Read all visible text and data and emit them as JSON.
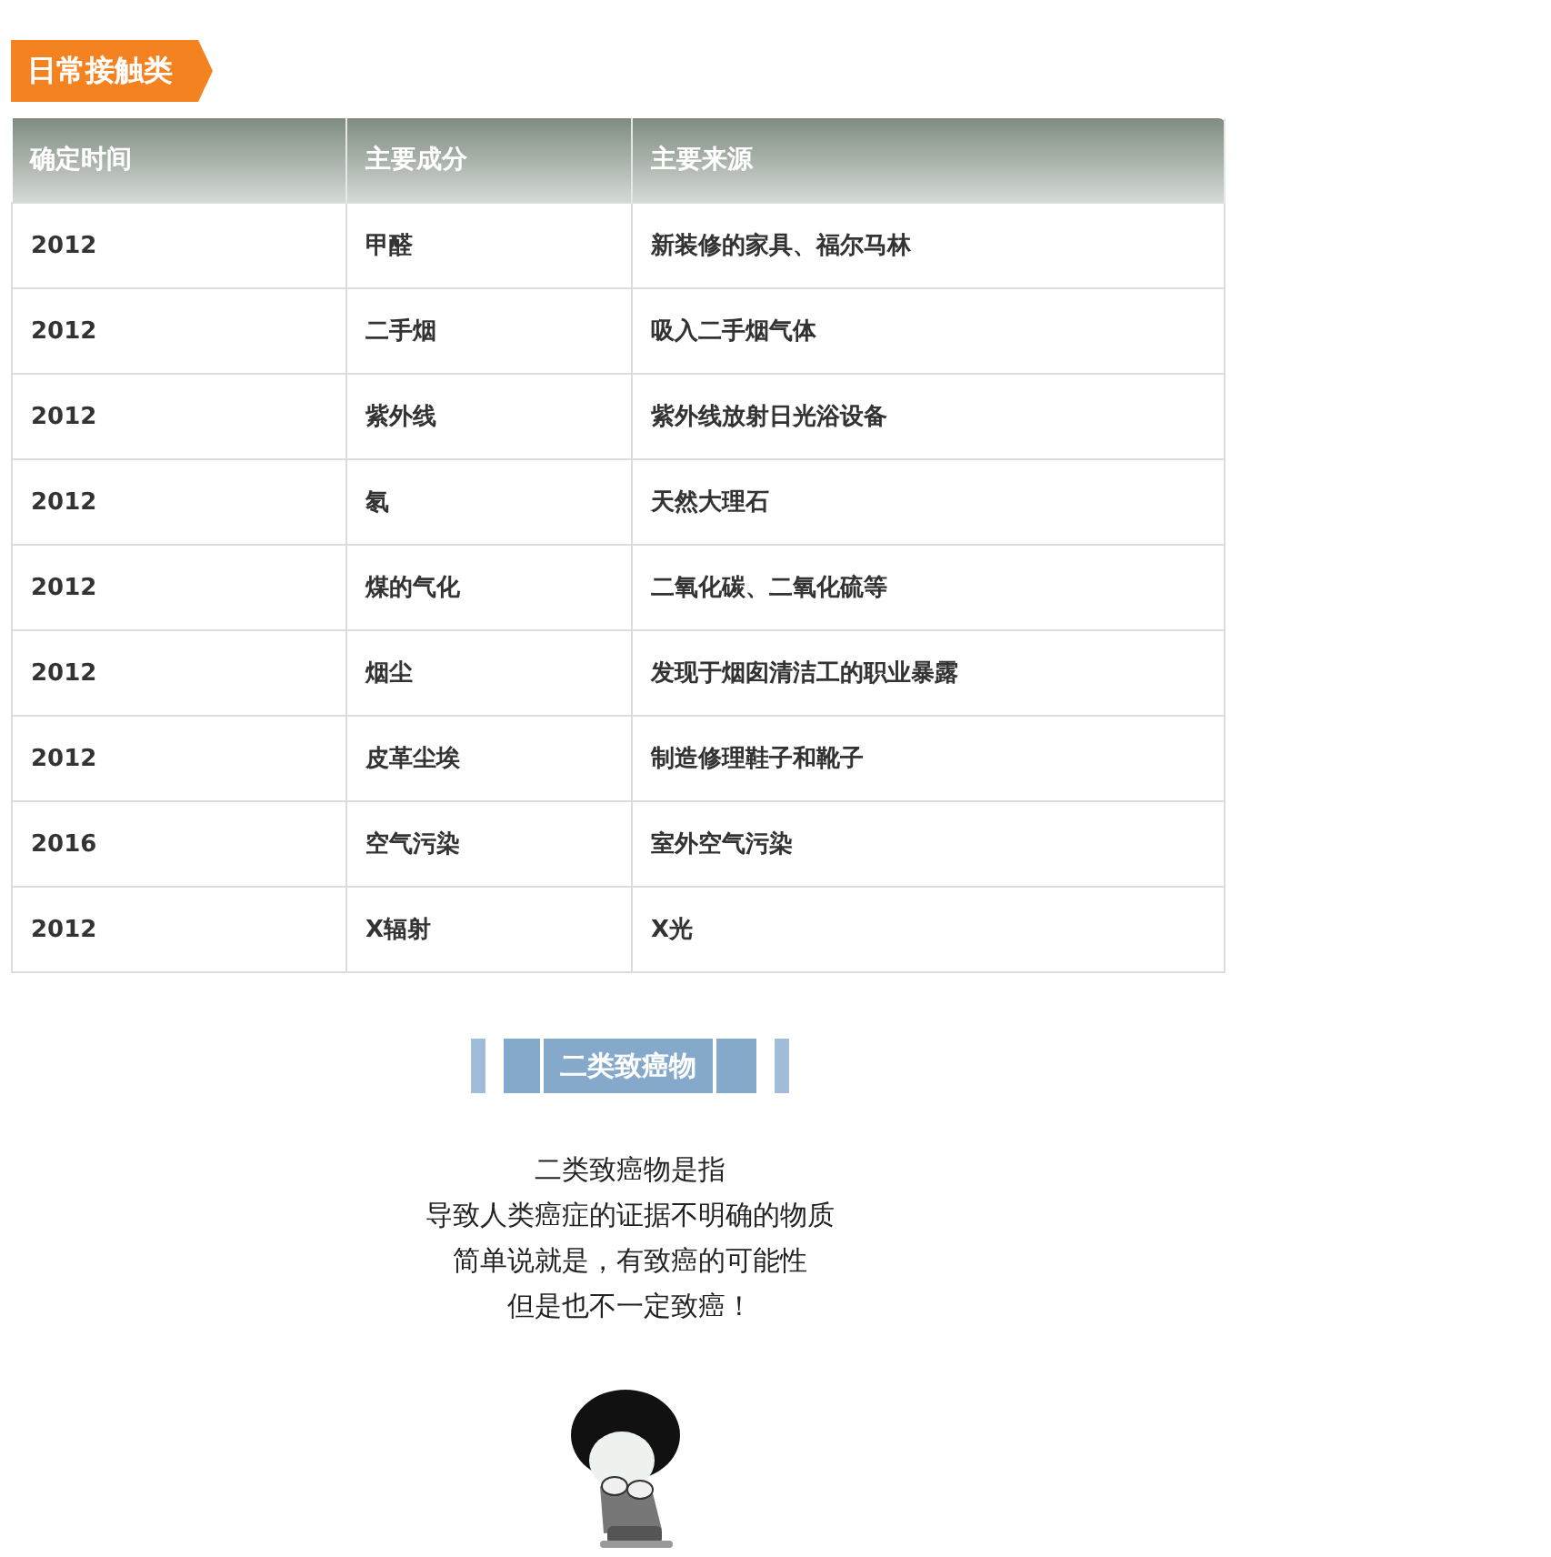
{
  "section_tag": "日常接触类",
  "table": {
    "columns": [
      "确定时间",
      "主要成分",
      "主要来源"
    ],
    "rows": [
      [
        "2012",
        "甲醛",
        "新装修的家具、福尔马林"
      ],
      [
        "2012",
        "二手烟",
        "吸入二手烟气体"
      ],
      [
        "2012",
        "紫外线",
        "紫外线放射日光浴设备"
      ],
      [
        "2012",
        "氡",
        "天然大理石"
      ],
      [
        "2012",
        "煤的气化",
        "二氧化碳、二氧化硫等"
      ],
      [
        "2012",
        "烟尘",
        "发现于烟囱清洁工的职业暴露"
      ],
      [
        "2012",
        "皮革尘埃",
        "制造修理鞋子和靴子"
      ],
      [
        "2016",
        "空气污染",
        "室外空气污染"
      ],
      [
        "2012",
        "X辐射",
        "X光"
      ]
    ]
  },
  "banner": {
    "title": "二类致癌物"
  },
  "paragraph_lines": [
    "二类致癌物是指",
    "导致人类癌症的证据不明确的物质",
    "简单说就是，有致癌的可能性",
    "但是也不一定致癌！"
  ]
}
